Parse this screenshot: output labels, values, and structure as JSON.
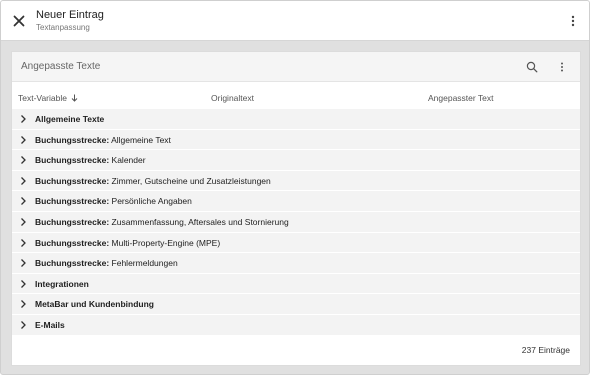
{
  "topbar": {
    "title": "Neuer Eintrag",
    "subtitle": "Textanpassung",
    "close_icon": "close-icon",
    "menu_icon": "more-vertical-icon"
  },
  "card": {
    "title": "Angepasste Texte",
    "search_icon": "search-icon",
    "menu_icon": "more-vertical-icon"
  },
  "table": {
    "columns": [
      "Text-Variable",
      "Originaltext",
      "Angepasster Text"
    ],
    "sort_icon": "arrow-down-icon",
    "groups": [
      {
        "bold": "Allgemeine Texte",
        "rest": ""
      },
      {
        "bold": "Buchungsstrecke:",
        "rest": " Allgemeine Text"
      },
      {
        "bold": "Buchungsstrecke:",
        "rest": " Kalender"
      },
      {
        "bold": "Buchungsstrecke:",
        "rest": " Zimmer, Gutscheine und Zusatzleistungen"
      },
      {
        "bold": "Buchungsstrecke:",
        "rest": " Persönliche Angaben"
      },
      {
        "bold": "Buchungsstrecke:",
        "rest": " Zusammenfassung, Aftersales und Stornierung"
      },
      {
        "bold": "Buchungsstrecke:",
        "rest": " Multi-Property-Engine (MPE)"
      },
      {
        "bold": "Buchungsstrecke:",
        "rest": " Fehlermeldungen"
      },
      {
        "bold": "Integrationen",
        "rest": ""
      },
      {
        "bold": "MetaBar und Kundenbindung",
        "rest": ""
      },
      {
        "bold": "E-Mails",
        "rest": ""
      }
    ]
  },
  "footer": {
    "count": "237 Einträge"
  },
  "colors": {
    "frame_bg": "#e0e0e0",
    "row_bg": "#f3f3f3",
    "header_bg": "#f5f5f5"
  }
}
